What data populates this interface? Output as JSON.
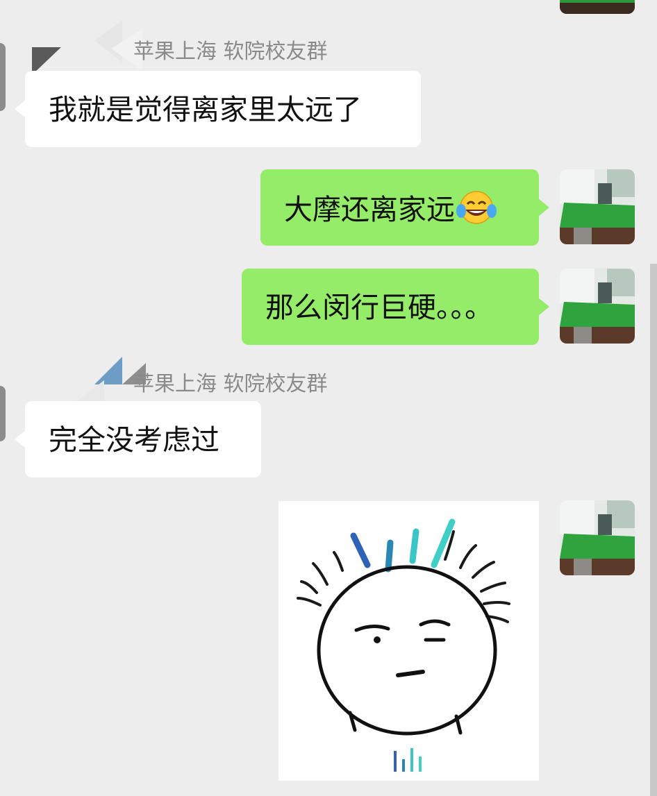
{
  "messages": [
    {
      "id": "m1",
      "direction": "in",
      "sender": "苹果上海 软院校友群",
      "text": "我就是觉得离家里太远了"
    },
    {
      "id": "m2",
      "direction": "out",
      "text": "大摩还离家远",
      "emoji": "tears-of-joy-emoji"
    },
    {
      "id": "m3",
      "direction": "out",
      "text": "那么闵行巨硬。。。"
    },
    {
      "id": "m4",
      "direction": "in",
      "sender": "苹果上海 软院校友群",
      "text": "完全没考虑过"
    },
    {
      "id": "m5",
      "direction": "out",
      "type": "sticker",
      "sticker": "spiky-hair-face-sticker",
      "sticker_text": "hıl"
    }
  ],
  "colors": {
    "background": "#ededed",
    "bubble_in": "#ffffff",
    "bubble_out": "#95ec69",
    "sender_name": "#8a8a8a"
  }
}
